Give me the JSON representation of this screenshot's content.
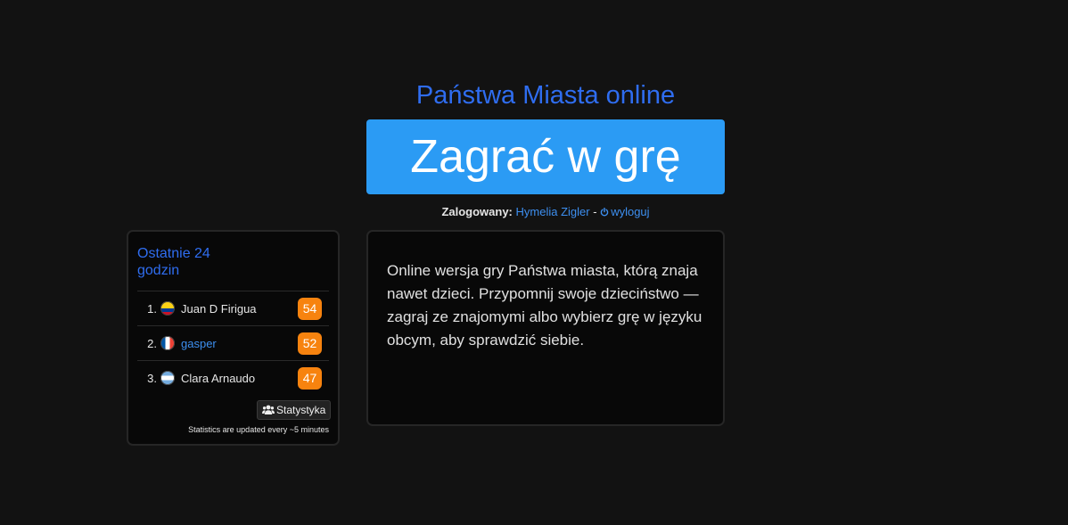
{
  "header": {
    "title": "Państwa Miasta online",
    "play_button_label": "Zagrać w grę"
  },
  "login": {
    "label": "Zalogowany:",
    "username": "Hymelia Zigler",
    "separator": "-",
    "logout_label": "wyloguj"
  },
  "stats": {
    "title": "Ostatnie 24 godzin",
    "players": [
      {
        "rank": "1.",
        "name": "Juan D Firigua",
        "flag": "colombia-flag-icon",
        "score": "54",
        "is_link": false
      },
      {
        "rank": "2.",
        "name": "gasper",
        "flag": "france-flag-icon",
        "score": "52",
        "is_link": true
      },
      {
        "rank": "3.",
        "name": "Clara Arnaudo",
        "flag": "argentina-flag-icon",
        "score": "47",
        "is_link": false
      }
    ],
    "button_label": "Statystyka",
    "note": "Statistics are updated every ~5 minutes"
  },
  "description": {
    "text": "Online wersja gry Państwa miasta, którą znaja nawet dzieci. Przypomnij swoje dzieciństwo — zagraj ze znajomymi albo wybierz grę w języku obcym, aby sprawdzić siebie."
  },
  "colors": {
    "background": "#121212",
    "accent_blue": "#2f6df0",
    "button_blue": "#2b9bf4",
    "badge_orange": "#f7830f"
  }
}
